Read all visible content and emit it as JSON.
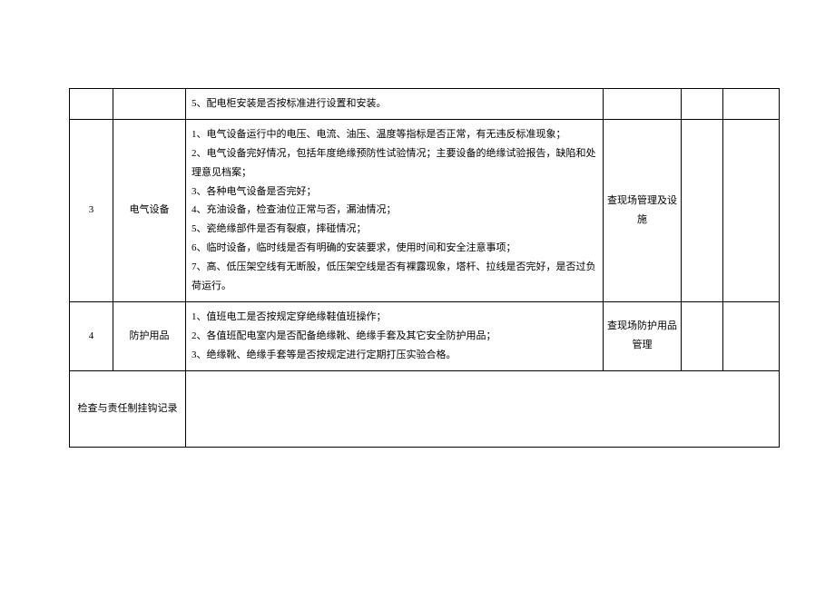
{
  "rows": [
    {
      "num": "",
      "category": "",
      "content_lines": [
        "5、配电柜安装是否按标准进行设置和安装。"
      ],
      "check": ""
    },
    {
      "num": "3",
      "category": "电气设备",
      "content_lines": [
        "1、电气设备运行中的电压、电流、油压、温度等指标是否正常，有无违反标准现象；",
        "2、电气设备完好情况，包括年度绝缘预防性试验情况；主要设备的绝缘试验报告，缺陷和处理意见档案；",
        "3、各种电气设备是否完好；",
        "4、充油设备，检查油位正常与否，漏油情况；",
        "5、瓷绝缘部件是否有裂痕，摔碰情况；",
        "6、临时设备，临时线是否有明确的安装要求，使用时间和安全注意事项；",
        "7、高、低压架空线有无断股，低压架空线是否有裸露现象，塔杆、拉线是否完好，是否过负荷运行。"
      ],
      "check": "查现场管理及设施"
    },
    {
      "num": "4",
      "category": "防护用品",
      "content_lines": [
        "1、值班电工是否按规定穿绝缘鞋值班操作；",
        "2、各值班配电室内是否配备绝缘靴、绝缘手套及其它安全防护用品；",
        "3、绝缘靴、绝缘手套等是否按规定进行定期打压实验合格。"
      ],
      "check": "查现场防护用品管理"
    }
  ],
  "footer_label": "检查与责任制挂钩记录"
}
